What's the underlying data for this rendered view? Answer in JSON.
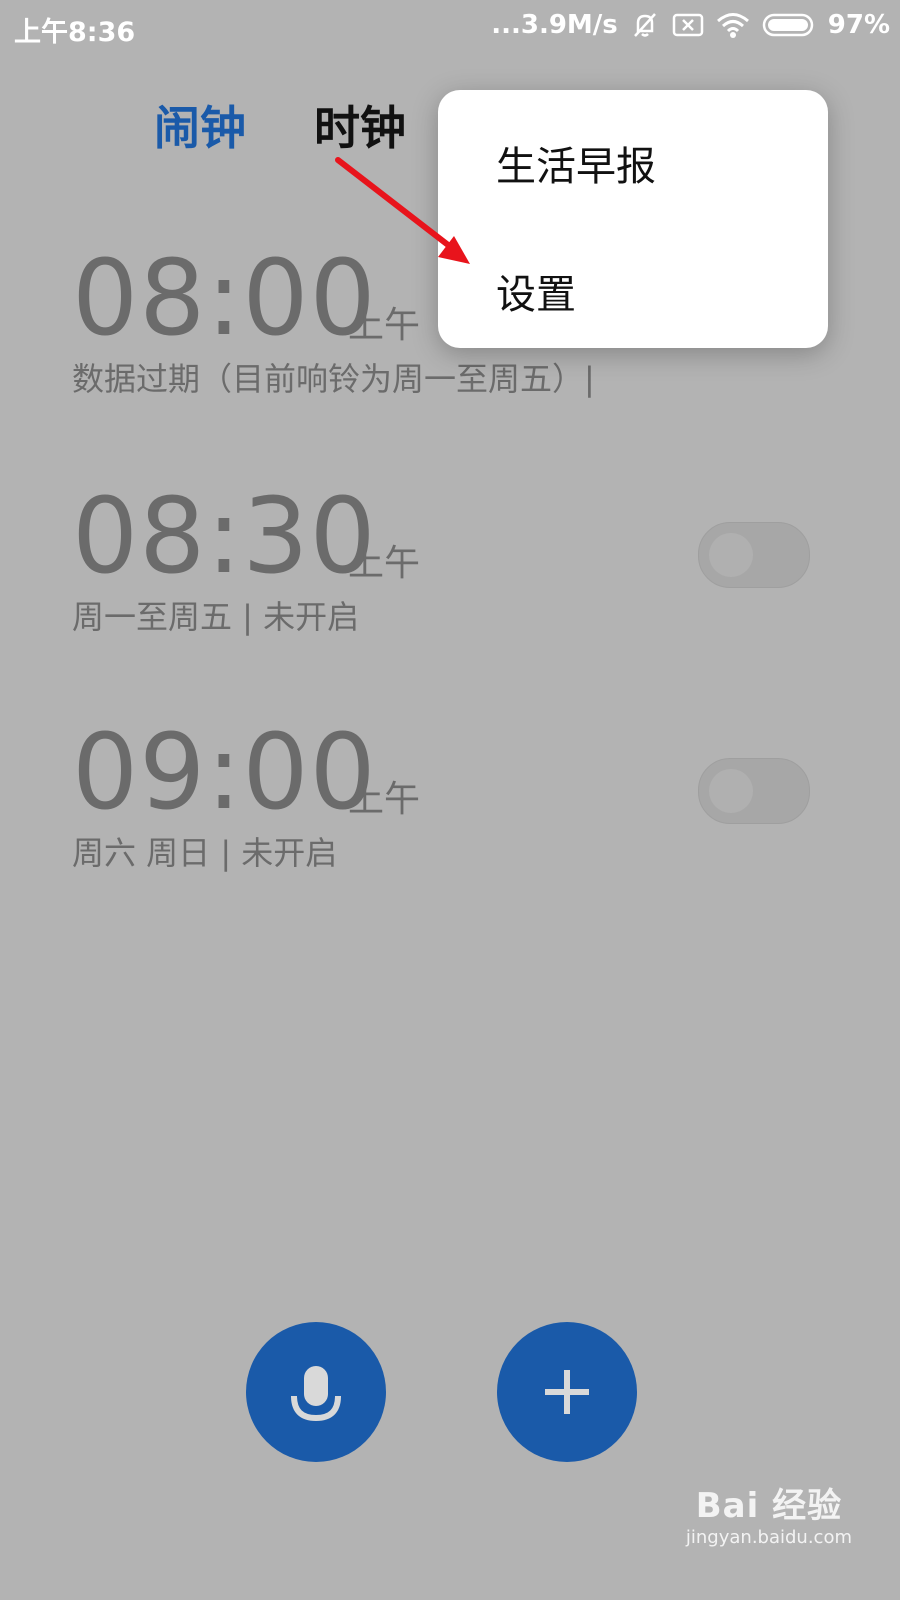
{
  "status_bar": {
    "time": "上午8:36",
    "network_speed": "...3.9M/s",
    "battery": "97%",
    "icons": [
      "mute-alarm-icon",
      "no-sim-icon",
      "wifi-icon",
      "battery-icon"
    ]
  },
  "tabs": [
    {
      "label": "闹钟",
      "active": true
    },
    {
      "label": "时钟",
      "active": false
    }
  ],
  "alarms": [
    {
      "time": "08:00",
      "ampm": "上午",
      "desc": "数据过期（目前响铃为周一至周五）|"
    },
    {
      "time": "08:30",
      "ampm": "上午",
      "desc": "周一至周五 | 未开启",
      "enabled": false
    },
    {
      "time": "09:00",
      "ampm": "上午",
      "desc": "周六 周日 | 未开启",
      "enabled": false
    }
  ],
  "popup_menu": {
    "items": [
      "生活早报",
      "设置"
    ]
  },
  "fabs": {
    "voice_icon": "microphone-icon",
    "add_icon": "plus-icon"
  },
  "watermark": {
    "logo": "Bai 经验",
    "url": "jingyan.baidu.com"
  },
  "colors": {
    "accent": "#1a5aa9",
    "background_dimmed": "#b3b3b3",
    "annotation_arrow": "#e8141c"
  }
}
